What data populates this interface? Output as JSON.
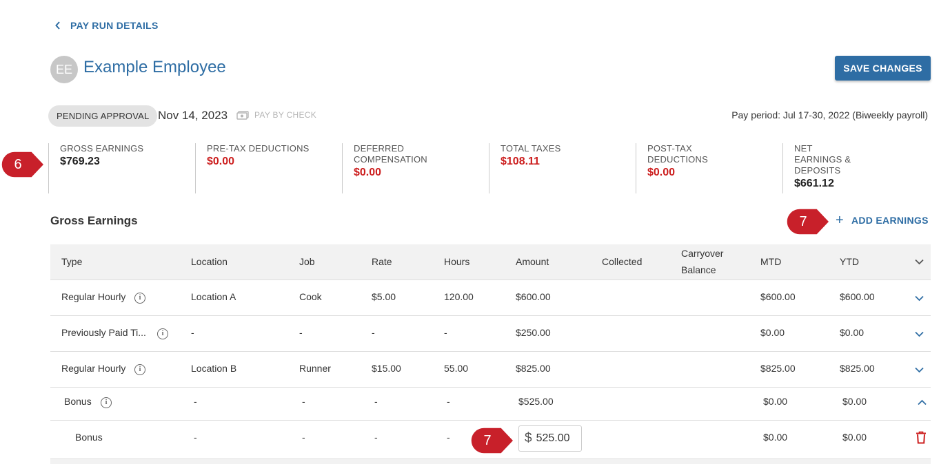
{
  "nav": {
    "back_label": "PAY RUN DETAILS"
  },
  "employee": {
    "initials": "EE",
    "name": "Example Employee"
  },
  "actions": {
    "save_label": "SAVE CHANGES",
    "add_earnings_label": "ADD EARNINGS"
  },
  "status": {
    "chip": "PENDING APPROVAL",
    "pay_date": "Nov 14, 2023",
    "pay_method": "PAY BY CHECK",
    "pay_period": "Pay period: Jul 17-30, 2022 (Biweekly payroll)"
  },
  "summary": [
    {
      "label": "GROSS EARNINGS",
      "value": "$769.23",
      "value_color": "#222222"
    },
    {
      "label": "PRE-TAX DEDUCTIONS",
      "value": "$0.00",
      "value_color": "#cc1e1e"
    },
    {
      "label": "DEFERRED COMPENSATION",
      "value": "$0.00",
      "value_color": "#cc1e1e"
    },
    {
      "label": "TOTAL TAXES",
      "value": "$108.11",
      "value_color": "#cc1e1e"
    },
    {
      "label": "POST-TAX DEDUCTIONS",
      "value": "$0.00",
      "value_color": "#cc1e1e"
    },
    {
      "label": "NET EARNINGS & DEPOSITS",
      "value": "$661.12",
      "value_color": "#222222"
    }
  ],
  "callouts": {
    "summary": "6",
    "add_earnings": "7",
    "amount_input": "7"
  },
  "section": {
    "title": "Gross Earnings"
  },
  "table": {
    "columns": [
      "Type",
      "Location",
      "Job",
      "Rate",
      "Hours",
      "Amount",
      "Collected",
      "Carryover",
      "Balance",
      "MTD",
      "YTD"
    ],
    "rows": [
      {
        "type": "Regular Hourly",
        "location": "Location A",
        "job": "Cook",
        "rate": "$5.00",
        "hours": "120.00",
        "amount": "$600.00",
        "collected": "",
        "carryover": "",
        "mtd": "$600.00",
        "ytd": "$600.00"
      },
      {
        "type": "Previously Paid Ti...",
        "location": "-",
        "job": "-",
        "rate": "-",
        "hours": "-",
        "amount": "$250.00",
        "collected": "",
        "carryover": "",
        "mtd": "$0.00",
        "ytd": "$0.00"
      },
      {
        "type": "Regular Hourly",
        "location": "Location B",
        "job": "Runner",
        "rate": "$15.00",
        "hours": "55.00",
        "amount": "$825.00",
        "collected": "",
        "carryover": "",
        "mtd": "$825.00",
        "ytd": "$825.00"
      },
      {
        "type": "Bonus",
        "location": "-",
        "job": "-",
        "rate": "-",
        "hours": "-",
        "amount": "$525.00",
        "collected": "",
        "carryover": "",
        "mtd": "$0.00",
        "ytd": "$0.00"
      }
    ],
    "sub_row": {
      "type": "Bonus",
      "location": "-",
      "job": "-",
      "rate": "-",
      "hours": "-",
      "amount_prefix": "$",
      "amount_value": "525.00",
      "mtd": "$0.00",
      "ytd": "$0.00"
    }
  },
  "colors": {
    "accent": "#2e6da4",
    "danger": "#cc1e1e",
    "callout": "#c8202a",
    "header_bg": "#f2f2f2"
  },
  "icons": [
    "chevron-left-icon",
    "check-icon",
    "info-icon",
    "chevron-down-icon",
    "chevron-up-icon",
    "plus-icon",
    "trash-icon"
  ]
}
